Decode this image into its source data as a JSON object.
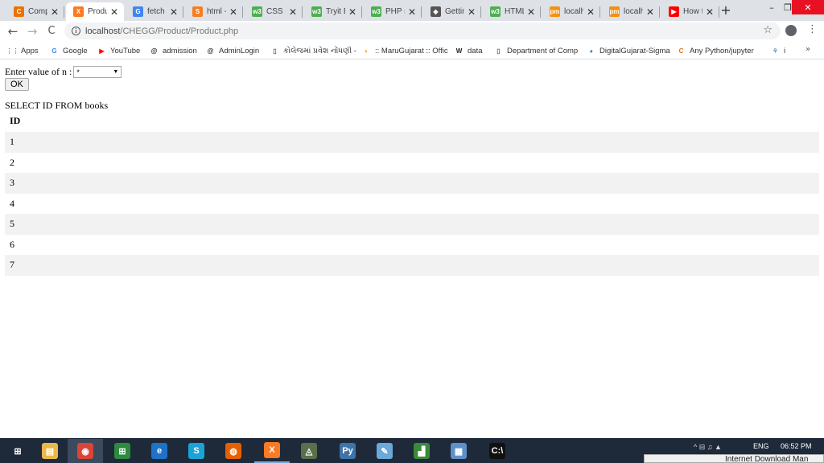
{
  "browser": {
    "tabs": [
      {
        "title": "Comp",
        "icon": "chegg-icon",
        "color": "#eb7100",
        "glyph": "C"
      },
      {
        "title": "Produ",
        "icon": "xampp-icon",
        "color": "#fb7a24",
        "glyph": "X",
        "active": true
      },
      {
        "title": "fetch",
        "icon": "google-icon",
        "color": "#4285f4",
        "glyph": "G"
      },
      {
        "title": "html -",
        "icon": "stackoverflow-icon",
        "color": "#f48024",
        "glyph": "S"
      },
      {
        "title": "CSS St",
        "icon": "w3schools-icon",
        "color": "#4caf50",
        "glyph": "w3"
      },
      {
        "title": "Tryit E",
        "icon": "w3schools-icon",
        "color": "#4caf50",
        "glyph": "w3"
      },
      {
        "title": "PHP n",
        "icon": "w3schools-icon",
        "color": "#4caf50",
        "glyph": "w3"
      },
      {
        "title": "Gettin",
        "icon": "diamond-icon",
        "color": "#555555",
        "glyph": "◈"
      },
      {
        "title": "HTML",
        "icon": "w3schools-icon",
        "color": "#4caf50",
        "glyph": "w3"
      },
      {
        "title": "localh",
        "icon": "phpmyadmin-icon",
        "color": "#f29111",
        "glyph": "pm"
      },
      {
        "title": "localh",
        "icon": "phpmyadmin-icon",
        "color": "#f29111",
        "glyph": "pm"
      },
      {
        "title": "How t",
        "icon": "youtube-icon",
        "color": "#ff0000",
        "glyph": "▶"
      }
    ],
    "new_tab": "+",
    "window": {
      "minimize": "–",
      "restore": "❐",
      "close": "✕"
    },
    "nav": {
      "back": "←",
      "forward": "→",
      "reload": "C"
    },
    "url": {
      "host": "localhost",
      "path": "/CHEGG/Product/Product.php"
    },
    "bookmarks": [
      {
        "label": "Apps",
        "icon": "apps-grid-icon",
        "glyph": "⋮⋮",
        "color": "#4285f4"
      },
      {
        "label": "Google",
        "icon": "google-icon",
        "glyph": "G",
        "color": "#4285f4"
      },
      {
        "label": "YouTube",
        "icon": "youtube-icon",
        "glyph": "▶",
        "color": "#ff0000"
      },
      {
        "label": "admission",
        "icon": "at-icon",
        "glyph": "@",
        "color": "#222222"
      },
      {
        "label": "AdminLogin",
        "icon": "at-icon",
        "glyph": "@",
        "color": "#222222"
      },
      {
        "label": "કોલેજમાં પ્રવેશ નોંધણી - ક્રમાં",
        "icon": "page-icon",
        "glyph": "▯",
        "color": "#666666"
      },
      {
        "label": ":: MaruGujarat :: Offic",
        "icon": "marugujarat-icon",
        "glyph": "◐",
        "color": "#e8a300"
      },
      {
        "label": "data",
        "icon": "wikipedia-icon",
        "glyph": "W",
        "color": "#222222"
      },
      {
        "label": "Department of Comp",
        "icon": "page-icon",
        "glyph": "▯",
        "color": "#666666"
      },
      {
        "label": "DigitalGujarat-Sigma",
        "icon": "digitalgujarat-icon",
        "glyph": "◕",
        "color": "#2a7fd4"
      },
      {
        "label": "Any Python/jupyter",
        "icon": "chegg-icon",
        "glyph": "C",
        "color": "#eb7100"
      },
      {
        "label": "i",
        "icon": "puzzle-icon",
        "glyph": "⚘",
        "color": "#7a9cc6"
      }
    ],
    "bookmarks_more": "»"
  },
  "page": {
    "prompt_label": "Enter value of n :",
    "select_value": "*",
    "ok_button": "OK",
    "query_text": "SELECT ID FROM books",
    "table": {
      "header": "ID",
      "rows": [
        "1",
        "2",
        "3",
        "4",
        "5",
        "6",
        "7"
      ]
    }
  },
  "taskbar": {
    "apps": [
      {
        "icon": "windows-start-icon",
        "glyph": "⊞",
        "color": "#1e2a3a"
      },
      {
        "icon": "file-explorer-icon",
        "glyph": "▤",
        "color": "#e8b84a"
      },
      {
        "icon": "chrome-icon",
        "glyph": "◉",
        "color": "#db4437",
        "active": true
      },
      {
        "icon": "store-icon",
        "glyph": "⊞",
        "color": "#2d8a3e"
      },
      {
        "icon": "edge-icon",
        "glyph": "e",
        "color": "#1e73c8"
      },
      {
        "icon": "skype-icon",
        "glyph": "S",
        "color": "#1aa3d8"
      },
      {
        "icon": "firefox-icon",
        "glyph": "◍",
        "color": "#e66000"
      },
      {
        "icon": "xampp-icon",
        "glyph": "X",
        "color": "#fb7a24",
        "open": true
      },
      {
        "icon": "network-app-icon",
        "glyph": "◬",
        "color": "#5a6f4a"
      },
      {
        "icon": "python-icon",
        "glyph": "Py",
        "color": "#3e74a8"
      },
      {
        "icon": "notes-icon",
        "glyph": "✎",
        "color": "#6aa9d8"
      },
      {
        "icon": "chart-app-icon",
        "glyph": "▟",
        "color": "#3a8a3a"
      },
      {
        "icon": "control-panel-icon",
        "glyph": "▦",
        "color": "#5f8fc8"
      },
      {
        "icon": "terminal-icon",
        "glyph": "C:\\",
        "color": "#111111"
      }
    ],
    "tray": "^ ⊟ ♫ ▲",
    "language": "ENG",
    "time": "06:52 PM",
    "notification_text": "Internet Download Man"
  }
}
